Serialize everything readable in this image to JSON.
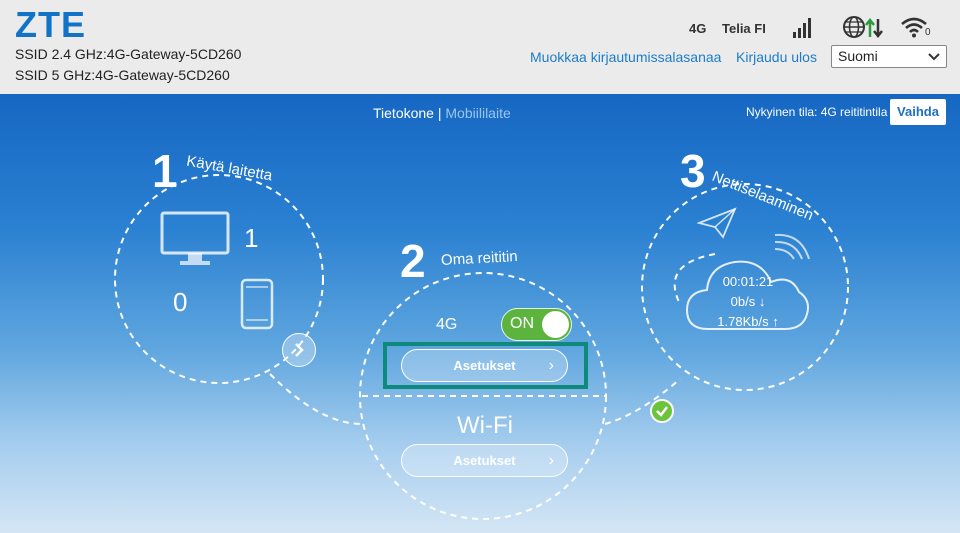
{
  "header": {
    "logo": "ZTE",
    "ssid_24": "SSID 2.4 GHz:4G-Gateway-5CD260",
    "ssid_5": "SSID 5 GHz:4G-Gateway-5CD260",
    "network_type": "4G",
    "operator": "Telia FI",
    "wifi_clients": "0",
    "change_password_link": "Muokkaa kirjautumissalasanaa",
    "logout_link": "Kirjaudu ulos",
    "language": "Suomi"
  },
  "mode": {
    "tab_computer": "Tietokone",
    "separator": "|",
    "tab_mobile": "Mobiililaite",
    "current_mode": "Nykyinen tila: 4G reititintila",
    "switch_button": "Vaihda"
  },
  "step1": {
    "number": "1",
    "label": "Käytä laitetta",
    "computers": "1",
    "mobiles": "0"
  },
  "step2": {
    "number": "2",
    "label": "Oma reititin",
    "mobile_label": "4G",
    "toggle_state": "ON",
    "settings_4g": "Asetukset",
    "wifi_label": "Wi-Fi",
    "settings_wifi": "Asetukset"
  },
  "step3": {
    "number": "3",
    "label": "Nettiselaaminen",
    "duration": "00:01:21",
    "upload": "0b/s ↓",
    "download": "1.78Kb/s ↑"
  },
  "colors": {
    "brand": "#1173c8",
    "accent_green": "#5cb43f",
    "highlight": "#0e8a7d"
  }
}
